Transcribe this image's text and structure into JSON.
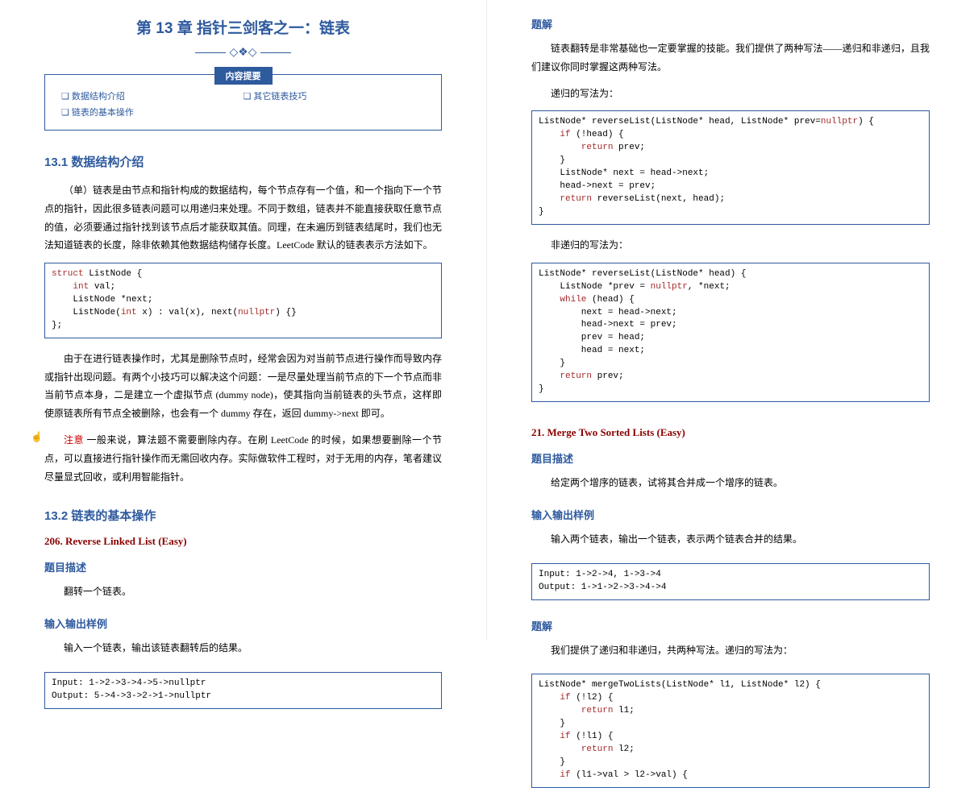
{
  "left": {
    "chapter_title": "第 13 章  指针三剑客之一：链表",
    "decor_char": "◇❖◇",
    "toc_tag": "内容提要",
    "toc": {
      "col1": [
        "数据结构介绍",
        "链表的基本操作"
      ],
      "col2": [
        "其它链表技巧"
      ]
    },
    "s131_h": "13.1  数据结构介绍",
    "s131_p1": "（单）链表是由节点和指针构成的数据结构，每个节点存有一个值，和一个指向下一个节点的指针，因此很多链表问题可以用递归来处理。不同于数组，链表并不能直接获取任意节点的值，必须要通过指针找到该节点后才能获取其值。同理，在未遍历到链表结尾时，我们也无法知道链表的长度，除非依赖其他数据结构储存长度。LeetCode 默认的链表表示方法如下。",
    "code1": "struct ListNode {\n    int val;\n    ListNode *next;\n    ListNode(int x) : val(x), next(nullptr) {}\n};",
    "s131_p2": "由于在进行链表操作时，尤其是删除节点时，经常会因为对当前节点进行操作而导致内存或指针出现问题。有两个小技巧可以解决这个问题：一是尽量处理当前节点的下一个节点而非当前节点本身，二是建立一个虚拟节点 (dummy node)，使其指向当前链表的头节点，这样即使原链表所有节点全被删除，也会有一个 dummy 存在，返回 dummy->next 即可。",
    "note_label": "注意",
    "s131_p3": " 一般来说，算法题不需要删除内存。在刷 LeetCode 的时候，如果想要删除一个节点，可以直接进行指针操作而无需回收内存。实际做软件工程时，对于无用的内存，笔者建议尽量显式回收，或利用智能指针。",
    "s132_h": "13.2  链表的基本操作",
    "p206_title": "206.  Reverse Linked List (Easy)",
    "h_desc": "题目描述",
    "p206_desc": "翻转一个链表。",
    "h_io": "输入输出样例",
    "p206_io_desc": "输入一个链表，输出该链表翻转后的结果。",
    "code2": "Input: 1->2->3->4->5->nullptr\nOutput: 5->4->3->2->1->nullptr"
  },
  "right": {
    "h_sol": "题解",
    "sol_p1": "链表翻转是非常基础也一定要掌握的技能。我们提供了两种写法——递归和非递归，且我们建议你同时掌握这两种写法。",
    "sol_rec_label": "递归的写法为：",
    "code_rec": "ListNode* reverseList(ListNode* head, ListNode* prev=nullptr) {\n    if (!head) {\n        return prev;\n    }\n    ListNode* next = head->next;\n    head->next = prev;\n    return reverseList(next, head);\n}",
    "sol_iter_label": "非递归的写法为：",
    "code_iter": "ListNode* reverseList(ListNode* head) {\n    ListNode *prev = nullptr, *next;\n    while (head) {\n        next = head->next;\n        head->next = prev;\n        prev = head;\n        head = next;\n    }\n    return prev;\n}",
    "p21_title": "21.  Merge Two Sorted Lists (Easy)",
    "p21_desc": "给定两个增序的链表，试将其合并成一个增序的链表。",
    "p21_io_desc": "输入两个链表，输出一个链表，表示两个链表合并的结果。",
    "code_io21": "Input: 1->2->4, 1->3->4\nOutput: 1->1->2->3->4->4",
    "p21_sol_p": "我们提供了递归和非递归，共两种写法。递归的写法为：",
    "code_merge": "ListNode* mergeTwoLists(ListNode* l1, ListNode* l2) {\n    if (!l2) {\n        return l1;\n    }\n    if (!l1) {\n        return l2;\n    }\n    if (l1->val > l2->val) {"
  }
}
